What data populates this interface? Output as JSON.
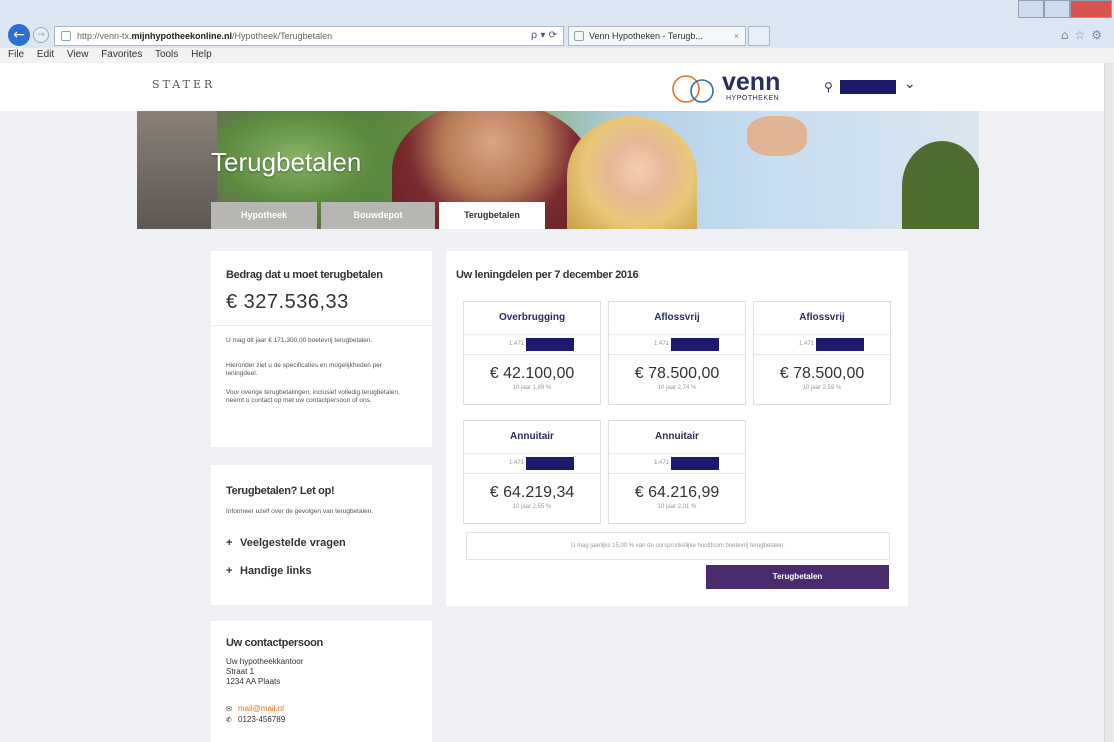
{
  "browser": {
    "url_prefix": "http://venn-tx.",
    "url_domain": "mijnhypotheekonline.nl",
    "url_path": "/Hypotheek/Terugbetalen",
    "addr_controls": "ρ ▾ ⟳",
    "tab_title": "Venn Hypotheken - Terugb...",
    "tab_close": "×",
    "menu": [
      "File",
      "Edit",
      "View",
      "Favorites",
      "Tools",
      "Help"
    ]
  },
  "header": {
    "stater_logo": "STATER",
    "brand_name": "venn",
    "brand_sub": "HYPOTHEKEN",
    "user_icon": "person-icon",
    "chevron": "⌄"
  },
  "hero": {
    "title": "Terugbetalen",
    "tabs": [
      {
        "label": "Hypotheek"
      },
      {
        "label": "Bouwdepot"
      },
      {
        "label": "Terugbetalen"
      }
    ]
  },
  "summary": {
    "heading": "Bedrag dat u moet terugbetalen",
    "amount": "€ 327.536,33",
    "p1": "U mag dit jaar € 171.300,00 boetevrij terugbetalen.",
    "p2": "Hieronder ziet u de specificaties en mogelijkheden per leningdeel.",
    "p3": "Voor overige terugbetalingen, inclusief volledig terugbetalen, neemt u contact op met uw contactpersoon of ons."
  },
  "letop": {
    "heading": "Terugbetalen? Let op!",
    "text": "Informeer uzelf over de gevolgen van terugbetalen.",
    "links": [
      "Veelgestelde vragen",
      "Handige links"
    ]
  },
  "contact": {
    "heading": "Uw contactpersoon",
    "lines": [
      "Uw hypotheekkantoor",
      "Straat 1",
      "1234 AA Plaats"
    ],
    "email": "mail@mail.nl",
    "phone": "0123-456789"
  },
  "loans": {
    "heading": "Uw leningdelen per 7 december 2016",
    "code_prefix": "1.471",
    "items": [
      {
        "name": "Overbrugging",
        "amount": "€ 42.100,00",
        "terms": "10 jaar 1,89 %"
      },
      {
        "name": "Aflossvrij",
        "amount": "€ 78.500,00",
        "terms": "10 jaar 2,74 %"
      },
      {
        "name": "Aflossvrij",
        "amount": "€ 78.500,00",
        "terms": "10 jaar 2,59 %"
      },
      {
        "name": "Annuitair",
        "amount": "€ 64.219,34",
        "terms": "10 jaar 2,55 %"
      },
      {
        "name": "Annuitair",
        "amount": "€ 64.216,99",
        "terms": "10 jaar 2,01 %"
      }
    ],
    "notice": "U mag jaarlijks 15,00 % van de oorspronkelijke hoofdsom boetevrij terugbetalen.",
    "button": "Terugbetalen"
  }
}
